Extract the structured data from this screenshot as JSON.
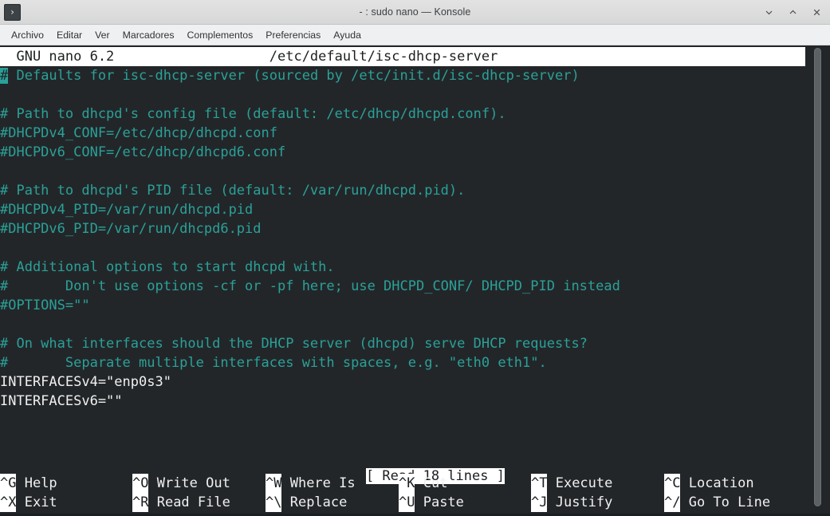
{
  "window": {
    "title": "- : sudo nano — Konsole",
    "icon": "terminal-prompt-icon",
    "buttons": {
      "minimize": "minimize-icon",
      "maximize": "maximize-icon",
      "close": "close-icon"
    }
  },
  "menubar": {
    "items": [
      {
        "label": "Archivo"
      },
      {
        "label": "Editar"
      },
      {
        "label": "Ver"
      },
      {
        "label": "Marcadores"
      },
      {
        "label": "Complementos"
      },
      {
        "label": "Preferencias"
      },
      {
        "label": "Ayuda"
      }
    ]
  },
  "nano": {
    "header": {
      "version": "GNU nano 6.2",
      "filename": "/etc/default/isc-dhcp-server",
      "full": "  GNU nano 6.2                   /etc/default/isc-dhcp-server"
    },
    "cursor": {
      "char": "#",
      "line": 1,
      "column": 1
    },
    "lines": [
      {
        "type": "comment",
        "cursor_first_char": true,
        "text": "# Defaults for isc-dhcp-server (sourced by /etc/init.d/isc-dhcp-server)"
      },
      {
        "type": "blank",
        "text": ""
      },
      {
        "type": "comment",
        "text": "# Path to dhcpd's config file (default: /etc/dhcp/dhcpd.conf)."
      },
      {
        "type": "comment",
        "text": "#DHCPDv4_CONF=/etc/dhcp/dhcpd.conf"
      },
      {
        "type": "comment",
        "text": "#DHCPDv6_CONF=/etc/dhcp/dhcpd6.conf"
      },
      {
        "type": "blank",
        "text": ""
      },
      {
        "type": "comment",
        "text": "# Path to dhcpd's PID file (default: /var/run/dhcpd.pid)."
      },
      {
        "type": "comment",
        "text": "#DHCPDv4_PID=/var/run/dhcpd.pid"
      },
      {
        "type": "comment",
        "text": "#DHCPDv6_PID=/var/run/dhcpd6.pid"
      },
      {
        "type": "blank",
        "text": ""
      },
      {
        "type": "comment",
        "text": "# Additional options to start dhcpd with."
      },
      {
        "type": "comment",
        "text": "#       Don't use options -cf or -pf here; use DHCPD_CONF/ DHCPD_PID instead"
      },
      {
        "type": "comment",
        "text": "#OPTIONS=\"\""
      },
      {
        "type": "blank",
        "text": ""
      },
      {
        "type": "comment",
        "text": "# On what interfaces should the DHCP server (dhcpd) serve DHCP requests?"
      },
      {
        "type": "comment",
        "text": "#       Separate multiple interfaces with spaces, e.g. \"eth0 eth1\"."
      },
      {
        "type": "code",
        "text": "INTERFACESv4=\"enp0s3\""
      },
      {
        "type": "code",
        "text": "INTERFACESv6=\"\""
      }
    ],
    "status_message": "[ Read 18 lines ]",
    "shortcuts_row1": [
      {
        "key": "^G",
        "label": "Help"
      },
      {
        "key": "^O",
        "label": "Write Out"
      },
      {
        "key": "^W",
        "label": "Where Is"
      },
      {
        "key": "^K",
        "label": "Cut"
      },
      {
        "key": "^T",
        "label": "Execute"
      },
      {
        "key": "^C",
        "label": "Location"
      }
    ],
    "shortcuts_row2": [
      {
        "key": "^X",
        "label": "Exit"
      },
      {
        "key": "^R",
        "label": "Read File"
      },
      {
        "key": "^\\",
        "label": "Replace"
      },
      {
        "key": "^U",
        "label": "Paste"
      },
      {
        "key": "^J",
        "label": "Justify"
      },
      {
        "key": "^/",
        "label": "Go To Line"
      }
    ]
  },
  "colors": {
    "terminal_background": "#232629",
    "comment_text": "#2aa198",
    "code_text": "#f0f0f0",
    "inverted_background": "#ffffff",
    "inverted_text": "#1c1f21",
    "titlebar_background": "#dcdcdc",
    "menubar_background": "#eff0f1"
  },
  "scrollbar": {
    "name": "vertical-scrollbar",
    "thumb_position": "top",
    "thumb_extent_percent": 98
  }
}
